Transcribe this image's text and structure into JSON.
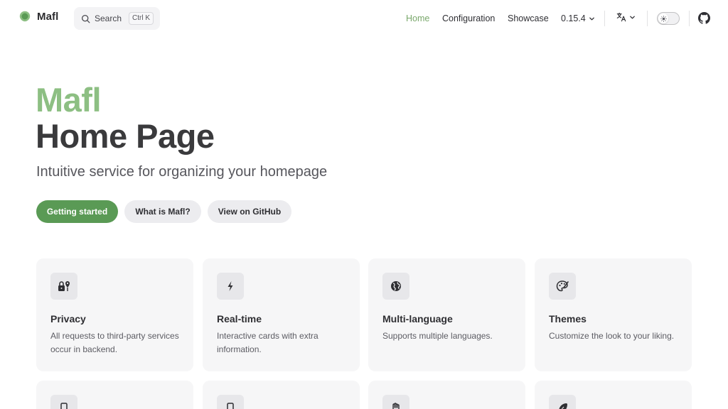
{
  "nav": {
    "brand": "Mafl",
    "search": {
      "label": "Search",
      "shortcut": "Ctrl K"
    },
    "items": [
      {
        "label": "Home",
        "active": true
      },
      {
        "label": "Configuration"
      },
      {
        "label": "Showcase"
      },
      {
        "label": "0.15.4"
      }
    ],
    "language_icon": "translate-icon",
    "theme_toggle_icon": "sun-icon",
    "github_icon": "github-icon"
  },
  "hero": {
    "name": "Mafl",
    "text": "Home Page",
    "tagline": "Intuitive service for organizing your homepage",
    "actions": [
      {
        "label": "Getting started",
        "theme": "brand"
      },
      {
        "label": "What is Mafl?",
        "theme": "alt"
      },
      {
        "label": "View on GitHub",
        "theme": "alt"
      }
    ]
  },
  "features": [
    {
      "icon": "lock-location-icon",
      "title": "Privacy",
      "desc": "All requests to third-party services occur in backend."
    },
    {
      "icon": "lightning-icon",
      "title": "Real-time",
      "desc": "Interactive cards with extra information."
    },
    {
      "icon": "globe-icon",
      "title": "Multi-language",
      "desc": "Supports multiple languages."
    },
    {
      "icon": "palette-icon",
      "title": "Themes",
      "desc": "Customize the look to your liking."
    },
    {
      "icon": "phone-icon",
      "title": "",
      "desc": ""
    },
    {
      "icon": "phone-icon",
      "title": "",
      "desc": ""
    },
    {
      "icon": "hand-icon",
      "title": "",
      "desc": ""
    },
    {
      "icon": "feather-icon",
      "title": "",
      "desc": ""
    }
  ],
  "colors": {
    "brand": "#5a9a55",
    "brand_light": "#8dbf83",
    "active_nav": "#7aa86c",
    "card_bg": "#f6f6f7"
  }
}
